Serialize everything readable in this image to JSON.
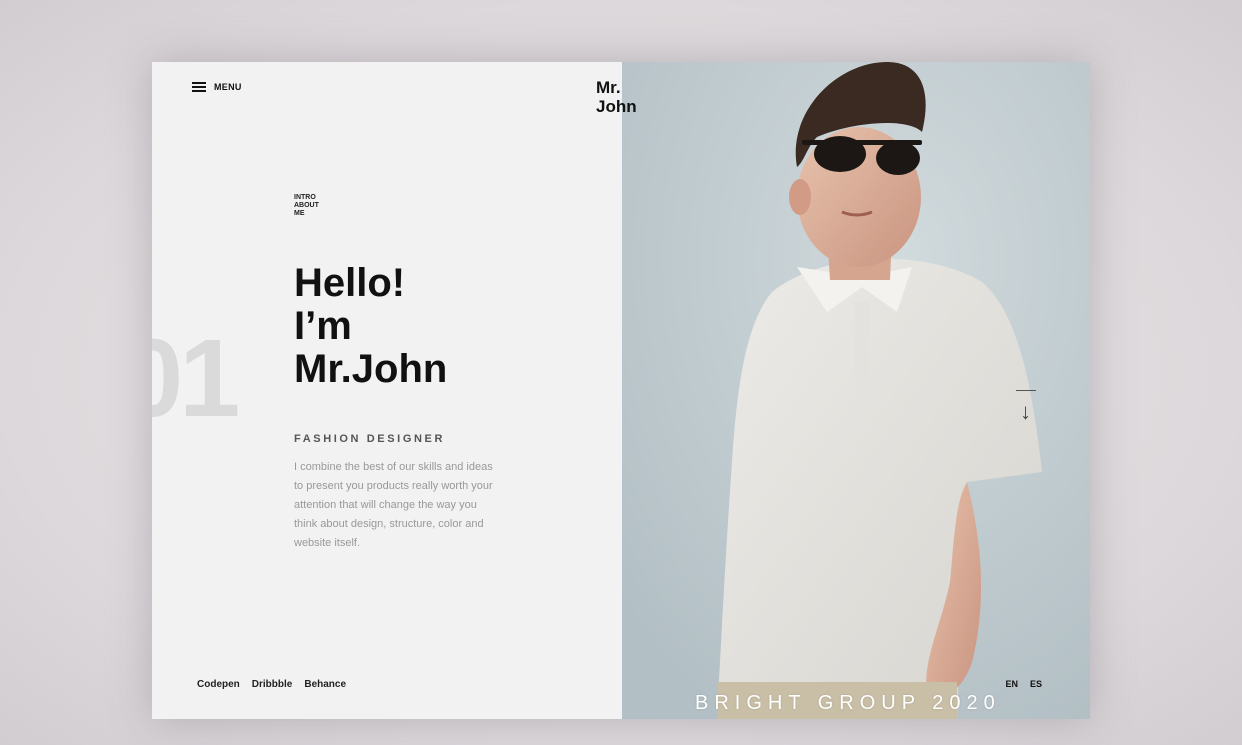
{
  "nav": {
    "menu_label": "MENU"
  },
  "brand": {
    "name": "Mr.\nJohn"
  },
  "intro": {
    "label": "INTRO\nABOUT\nME"
  },
  "hero": {
    "number": "01",
    "greeting": "Hello!\nI’m\nMr.John",
    "role": "FASHION DESIGNER",
    "description": "I combine the best of our skills and ideas to present you products really worth your attention that will change the way you think about design, structure, color and website itself."
  },
  "social": {
    "links": [
      "Codepen",
      "Dribbble",
      "Behance"
    ]
  },
  "languages": [
    "EN",
    "ES"
  ],
  "scroll": {
    "icon": "arrow-down-icon"
  },
  "watermark": "BRIGHT GROUP 2020",
  "colors": {
    "left_bg": "#f2f2f2",
    "right_bg": "#bcc8cd",
    "text": "#111111",
    "muted": "#999999"
  }
}
